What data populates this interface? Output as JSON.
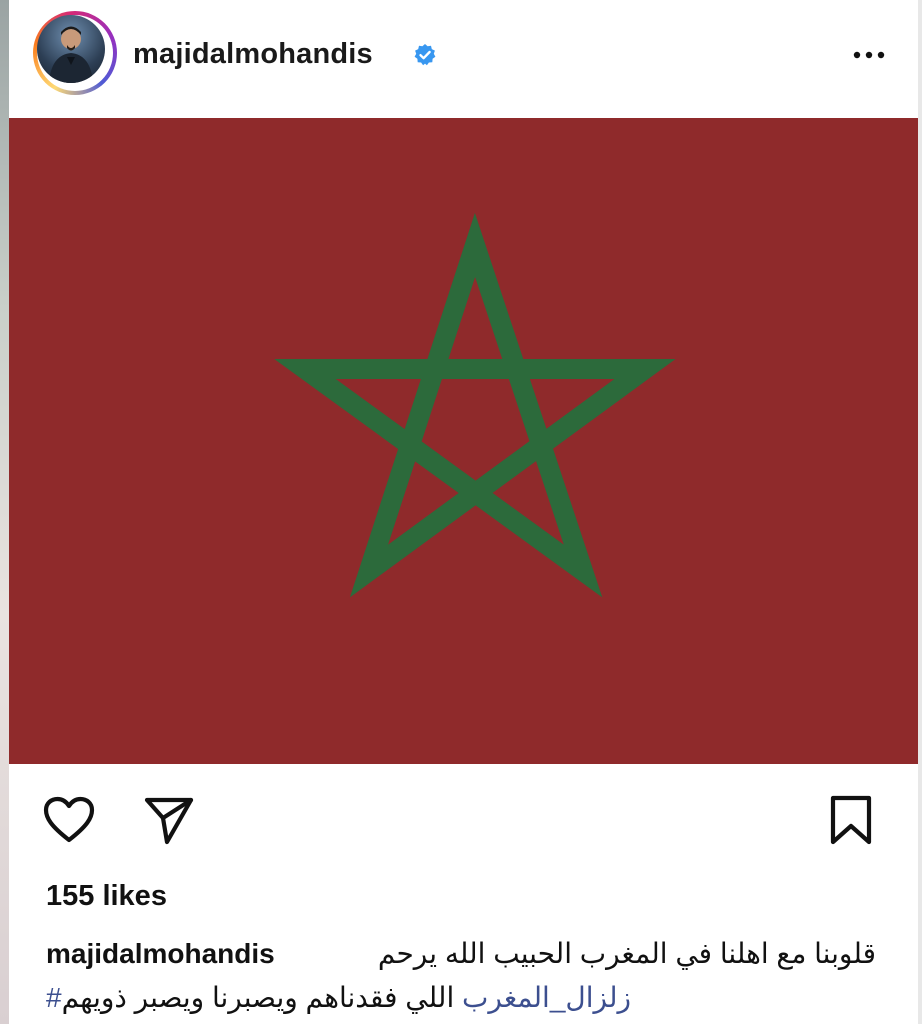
{
  "post": {
    "username": "majidalmohandis",
    "verified_icon": "verified-badge-icon",
    "more_icon": "more-options-icon",
    "image_alt": "Flag of Morocco",
    "colors": {
      "flag_red": "#8f2a2b",
      "flag_green": "#2c6a3b",
      "verified_blue": "#3897f0",
      "hashtag": "#3c4f8f"
    }
  },
  "actions": {
    "like_icon": "heart-icon",
    "share_icon": "paper-plane-icon",
    "save_icon": "bookmark-icon"
  },
  "likes_text": "155 likes",
  "caption": {
    "username": "majidalmohandis",
    "line1": "قلوبنا مع اهلنا في المغرب الحبيب الله يرحم",
    "line2": "اللي فقدناهم ويصبرنا ويصبر ذويهم",
    "hashtag": "#زلزال_المغرب"
  }
}
